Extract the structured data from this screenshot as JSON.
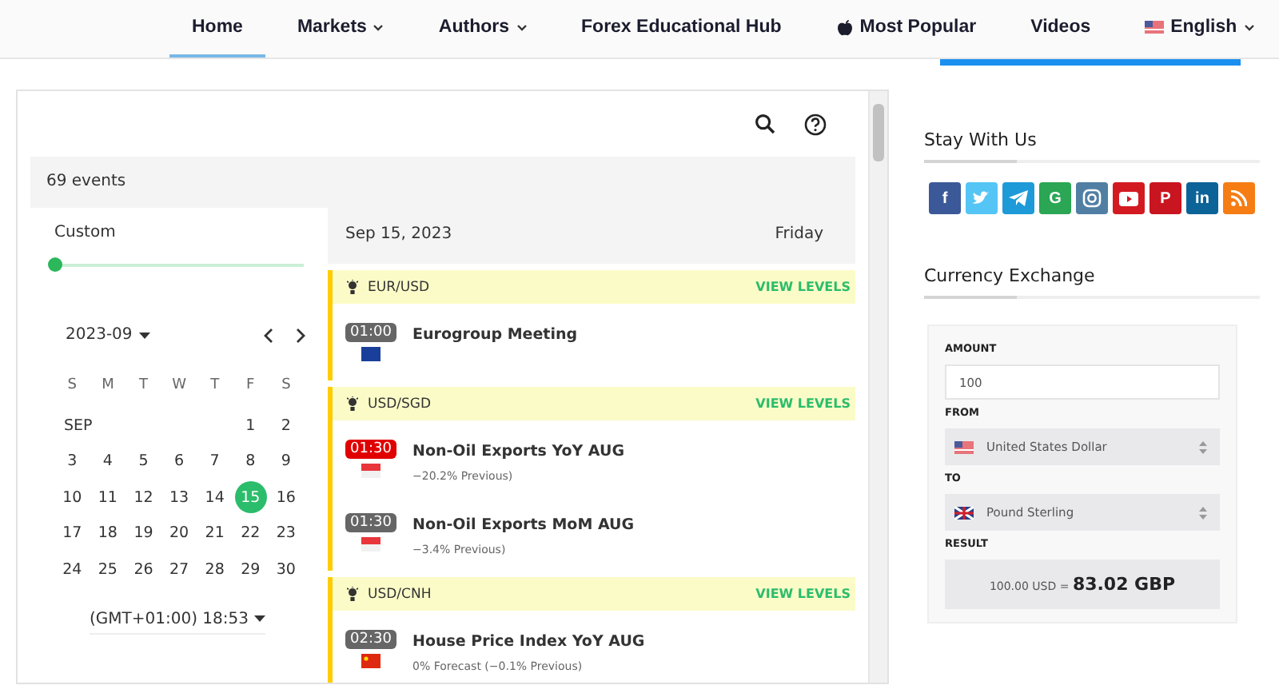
{
  "nav": {
    "items": [
      {
        "label": "Home",
        "selected": true,
        "kind": "plain"
      },
      {
        "label": "Markets",
        "selected": false,
        "kind": "menu"
      },
      {
        "label": "Authors",
        "selected": false,
        "kind": "menu"
      },
      {
        "label": "Forex Educational Hub",
        "selected": false,
        "kind": "plain"
      },
      {
        "label": "Most Popular",
        "selected": false,
        "kind": "icon"
      },
      {
        "label": "Videos",
        "selected": false,
        "kind": "plain"
      },
      {
        "label": "English",
        "selected": false,
        "kind": "language"
      }
    ]
  },
  "calendar_panel": {
    "events_count": "69 events",
    "range": {
      "label": "Custom",
      "level": 0
    },
    "month": "2023-09",
    "weekdays": [
      "S",
      "M",
      "T",
      "W",
      "T",
      "F",
      "S"
    ],
    "weeks": [
      {
        "label": "SEP",
        "days": [
          {
            "text": "1",
            "selected": false
          },
          {
            "text": "2",
            "selected": false
          }
        ]
      },
      {
        "days": [
          {
            "text": "3",
            "selected": false
          },
          {
            "text": "4",
            "selected": false
          },
          {
            "text": "5",
            "selected": false
          },
          {
            "text": "6",
            "selected": false
          },
          {
            "text": "7",
            "selected": false
          },
          {
            "text": "8",
            "selected": false
          },
          {
            "text": "9",
            "selected": false
          }
        ]
      },
      {
        "days": [
          {
            "text": "10",
            "selected": false
          },
          {
            "text": "11",
            "selected": false
          },
          {
            "text": "12",
            "selected": false
          },
          {
            "text": "13",
            "selected": false
          },
          {
            "text": "14",
            "selected": false
          },
          {
            "text": "15",
            "selected": true
          },
          {
            "text": "16",
            "selected": false
          }
        ]
      },
      {
        "days": [
          {
            "text": "17",
            "selected": false
          },
          {
            "text": "18",
            "selected": false
          },
          {
            "text": "19",
            "selected": false
          },
          {
            "text": "20",
            "selected": false
          },
          {
            "text": "21",
            "selected": false
          },
          {
            "text": "22",
            "selected": false
          },
          {
            "text": "23",
            "selected": false
          }
        ]
      },
      {
        "days": [
          {
            "text": "24",
            "selected": false
          },
          {
            "text": "25",
            "selected": false
          },
          {
            "text": "26",
            "selected": false
          },
          {
            "text": "27",
            "selected": false
          },
          {
            "text": "28",
            "selected": false
          },
          {
            "text": "29",
            "selected": false
          },
          {
            "text": "30",
            "selected": false
          }
        ]
      }
    ],
    "timezone": "(GMT+01:00) 18:53",
    "date": "Sep 15, 2023",
    "weekday": "Friday",
    "groups": [
      {
        "pair": "EUR/USD",
        "action": "VIEW LEVELS",
        "events": [
          {
            "time": "01:00",
            "high_impact": false,
            "kind": "eu",
            "title": "Eurogroup Meeting"
          }
        ]
      },
      {
        "pair": "USD/SGD",
        "action": "VIEW LEVELS",
        "events": [
          {
            "time": "01:30",
            "high_impact": true,
            "kind": "sg",
            "title": "Non-Oil Exports YoY AUG",
            "detail": "−20.2% Previous)"
          },
          {
            "time": "01:30",
            "high_impact": false,
            "kind": "sg",
            "title": "Non-Oil Exports MoM AUG",
            "detail": "−3.4% Previous)"
          }
        ]
      },
      {
        "pair": "USD/CNH",
        "action": "VIEW LEVELS",
        "events": [
          {
            "time": "02:30",
            "high_impact": false,
            "kind": "cn",
            "title": "House Price Index YoY AUG",
            "detail": "0% Forecast (−0.1% Previous)"
          }
        ]
      }
    ]
  },
  "sidebar": {
    "social": {
      "title": "Stay With Us",
      "icons": [
        {
          "kind": "letter",
          "label": "f",
          "color": "#3b5998"
        },
        {
          "kind": "bird",
          "color": "#55c5f5"
        },
        {
          "kind": "plane",
          "color": "#1e9ad8"
        },
        {
          "kind": "letter",
          "label": "G",
          "color": "#2aa654"
        },
        {
          "kind": "camera",
          "color": "#517fa4"
        },
        {
          "kind": "play",
          "color": "#d31a21"
        },
        {
          "kind": "letter",
          "label": "P",
          "color": "#c9151f"
        },
        {
          "kind": "letter",
          "label": "in",
          "color": "#0b6398"
        },
        {
          "kind": "rss",
          "color": "#f57d14"
        }
      ]
    },
    "exchange": {
      "title": "Currency Exchange",
      "amount_label": "AMOUNT",
      "amount": "100",
      "from_label": "FROM",
      "from": {
        "kind": "us",
        "value": "United States Dollar"
      },
      "to_label": "TO",
      "to": {
        "kind": "gb",
        "value": "Pound Sterling"
      },
      "result_label": "RESULT",
      "result": "100.00 USD = **83.02 GBP**"
    }
  }
}
